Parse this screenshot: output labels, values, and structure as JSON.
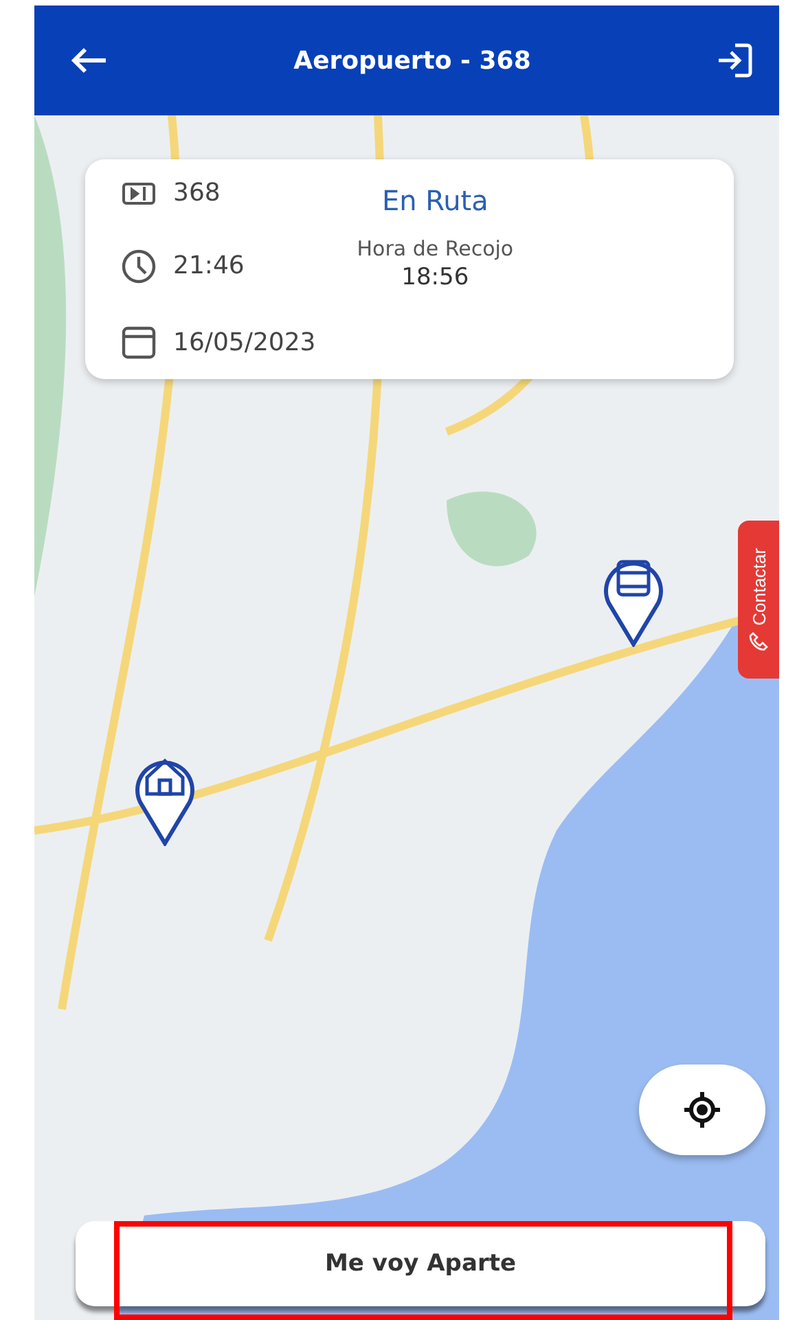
{
  "header": {
    "title": "Aeropuerto - 368"
  },
  "trip_card": {
    "route_number": "368",
    "status": "En Ruta",
    "time": "21:46",
    "pickup_label": "Hora de Recojo",
    "pickup_time": "18:56",
    "date": "16/05/2023"
  },
  "contact_tab": {
    "label": "Contactar"
  },
  "action_button": {
    "label": "Me voy Aparte"
  }
}
